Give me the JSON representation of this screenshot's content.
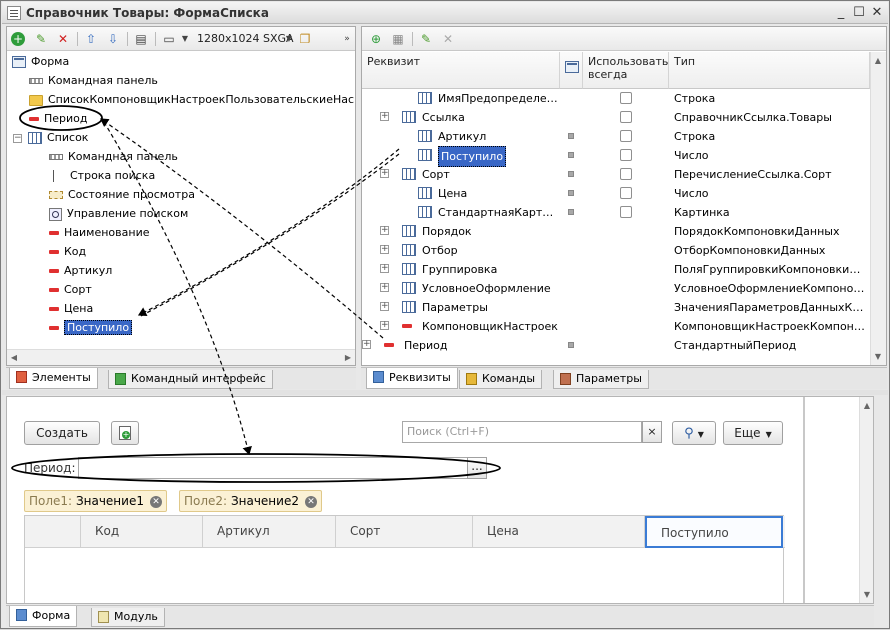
{
  "window": {
    "title": "Справочник Товары: ФормаСписка",
    "min_label": "_",
    "max_label": "☐",
    "close_label": "✕"
  },
  "left_toolbar": {
    "resolution": "1280x1024 SXGA",
    "icons": [
      "add-icon",
      "edit-icon",
      "delete-icon",
      "move-up-icon",
      "move-down-icon",
      "form-item-icon",
      "layout-icon",
      "copy-icon"
    ]
  },
  "tree": {
    "items": [
      {
        "label": "Форма",
        "icon": "form-icon"
      },
      {
        "label": "Командная панель",
        "icon": "command-panel-icon"
      },
      {
        "label": "СписокКомпоновщикНастроекПользовательскиеНастройки",
        "icon": "folder-icon"
      },
      {
        "label": "Период",
        "icon": "field-icon"
      },
      {
        "label": "Список",
        "icon": "table-icon"
      },
      {
        "label": "Командная панель",
        "icon": "command-panel-icon"
      },
      {
        "label": "Строка поиска",
        "icon": "search-line-icon"
      },
      {
        "label": "Состояние просмотра",
        "icon": "view-state-icon"
      },
      {
        "label": "Управление поиском",
        "icon": "search-control-icon"
      },
      {
        "label": "Наименование",
        "icon": "field-icon"
      },
      {
        "label": "Код",
        "icon": "field-icon"
      },
      {
        "label": "Артикул",
        "icon": "field-icon"
      },
      {
        "label": "Сорт",
        "icon": "field-icon"
      },
      {
        "label": "Цена",
        "icon": "field-icon"
      },
      {
        "label": "Поступило",
        "icon": "field-icon"
      }
    ]
  },
  "left_tabs": [
    {
      "label": "Элементы"
    },
    {
      "label": "Командный интерфейс"
    }
  ],
  "attributes": {
    "headers": {
      "name": "Реквизит",
      "use_always": "Использовать всегда",
      "type": "Тип"
    },
    "rows": [
      {
        "name": "ИмяПредопределенныхДанных",
        "type": "Строка"
      },
      {
        "name": "Ссылка",
        "type": "СправочникСсылка.Товары"
      },
      {
        "name": "Артикул",
        "type": "Строка"
      },
      {
        "name": "Поступило",
        "type": "Число"
      },
      {
        "name": "Сорт",
        "type": "ПеречислениеСсылка.Сорт"
      },
      {
        "name": "Цена",
        "type": "Число"
      },
      {
        "name": "СтандартнаяКартинка",
        "type": "Картинка"
      },
      {
        "name": "Порядок",
        "type": "ПорядокКомпоновкиДанных"
      },
      {
        "name": "Отбор",
        "type": "ОтборКомпоновкиДанных"
      },
      {
        "name": "Группировка",
        "type": "ПоляГруппировкиКомпоновкиДанных"
      },
      {
        "name": "УсловноеОформление",
        "type": "УсловноеОформлениеКомпоновки"
      },
      {
        "name": "Параметры",
        "type": "ЗначенияПараметровДанныхКомпоновки"
      },
      {
        "name": "КомпоновщикНастроек",
        "type": "КомпоновщикНастроекКомпоновки"
      },
      {
        "name": "Период",
        "type": "СтандартныйПериод"
      }
    ]
  },
  "right_tabs": [
    {
      "label": "Реквизиты"
    },
    {
      "label": "Команды"
    },
    {
      "label": "Параметры"
    }
  ],
  "preview": {
    "create_label": "Создать",
    "search_placeholder": "Поиск (Ctrl+F)",
    "clear_label": "×",
    "more_label": "Еще",
    "period_label": "Период:",
    "ellipsis": "...",
    "chips": [
      {
        "field": "Поле1:",
        "value": "Значение1"
      },
      {
        "field": "Поле2:",
        "value": "Значение2"
      }
    ],
    "columns": [
      "Код",
      "Артикул",
      "Сорт",
      "Цена",
      "Поступило"
    ]
  },
  "bottom_tabs": [
    {
      "label": "Форма"
    },
    {
      "label": "Модуль"
    }
  ],
  "colors": {
    "selection": "#3967c6",
    "field_icon": "#e03030",
    "chip_bg": "#fbf1d5"
  }
}
